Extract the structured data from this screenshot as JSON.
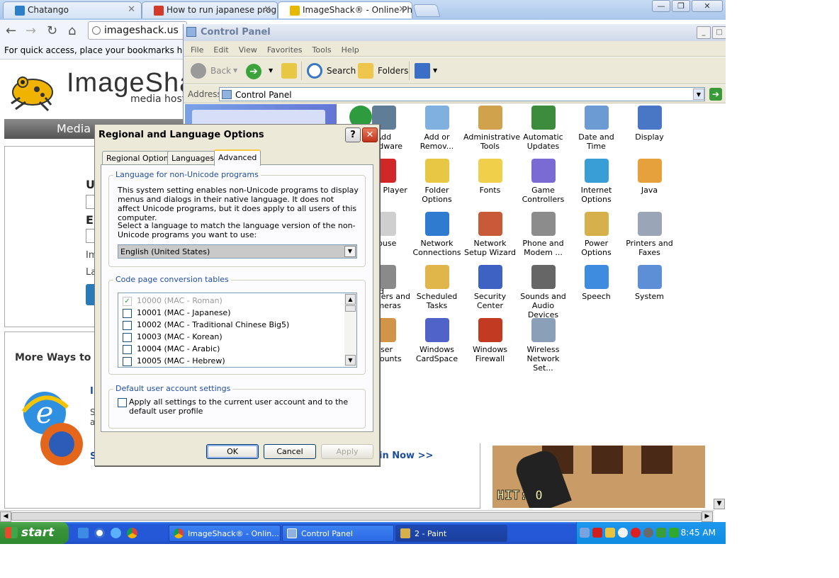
{
  "browser": {
    "tabs": [
      {
        "title": "Chatango"
      },
      {
        "title": "How to run japanese program"
      },
      {
        "title": "ImageShack® - Online Photo"
      }
    ],
    "url": "imageshack.us",
    "bookmark_hint": "For quick access, place your bookmarks here on the"
  },
  "imageshack": {
    "logo_text": "ImageShac",
    "logo_sub": "media hosti",
    "media_bar": "Media I",
    "letters": {
      "u": "U",
      "e": "E",
      "im": "Im",
      "la": "La"
    },
    "more_ways": "More Ways to Up",
    "sign_in": "in Now >>",
    "hit_label": "HIT: 0",
    "side_letters": {
      "i": "I",
      "s": "S",
      "a": "a",
      "s2": "S"
    }
  },
  "control_panel": {
    "title": "Control Panel",
    "menu": [
      "File",
      "Edit",
      "View",
      "Favorites",
      "Tools",
      "Help"
    ],
    "toolbar": {
      "back": "Back",
      "search": "Search",
      "folders": "Folders"
    },
    "address_label": "Address",
    "address_value": "Control Panel",
    "items": [
      {
        "label": "Add Hardware",
        "icon": "hardware-icon"
      },
      {
        "label": "Add or Remov...",
        "icon": "add-remove-icon"
      },
      {
        "label": "Administrative Tools",
        "icon": "admin-tools-icon"
      },
      {
        "label": "Automatic Updates",
        "icon": "updates-icon"
      },
      {
        "label": "Date and Time",
        "icon": "clock-icon"
      },
      {
        "label": "Display",
        "icon": "display-icon"
      },
      {
        "label": "Flash Player",
        "icon": "flash-icon"
      },
      {
        "label": "Folder Options",
        "icon": "folder-icon"
      },
      {
        "label": "Fonts",
        "icon": "fonts-icon"
      },
      {
        "label": "Game Controllers",
        "icon": "gamepad-icon"
      },
      {
        "label": "Internet Options",
        "icon": "globe-icon"
      },
      {
        "label": "Java",
        "icon": "java-icon"
      },
      {
        "label": "Mouse",
        "icon": "mouse-icon"
      },
      {
        "label": "Network Connections",
        "icon": "network-icon"
      },
      {
        "label": "Network Setup Wizard",
        "icon": "network-house-icon"
      },
      {
        "label": "Phone and Modem ...",
        "icon": "phone-icon"
      },
      {
        "label": "Power Options",
        "icon": "power-icon"
      },
      {
        "label": "Printers and Faxes",
        "icon": "printer-icon"
      },
      {
        "label": "Scanners and Cameras",
        "icon": "scanner-icon"
      },
      {
        "label": "Scheduled Tasks",
        "icon": "tasks-icon"
      },
      {
        "label": "Security Center",
        "icon": "shield-icon"
      },
      {
        "label": "Sounds and Audio Devices",
        "icon": "speaker-icon"
      },
      {
        "label": "Speech",
        "icon": "speech-icon"
      },
      {
        "label": "System",
        "icon": "system-icon"
      },
      {
        "label": "User Accounts",
        "icon": "users-icon"
      },
      {
        "label": "Windows CardSpace",
        "icon": "cardspace-icon"
      },
      {
        "label": "Windows Firewall",
        "icon": "firewall-icon"
      },
      {
        "label": "Wireless Network Set...",
        "icon": "wireless-icon"
      }
    ],
    "partial_letters": {
      "l1": "l",
      "d": "d",
      "l2": "l"
    }
  },
  "dialog": {
    "title": "Regional and Language Options",
    "tabs": [
      "Regional Options",
      "Languages",
      "Advanced"
    ],
    "active_tab": "Advanced",
    "group_nonunicode": {
      "label": "Language for non-Unicode programs",
      "desc": "This system setting enables non-Unicode programs to display menus and dialogs in their native language. It does not affect Unicode programs, but it does apply to all users of this computer.",
      "prompt": "Select a language to match the language version of the non-Unicode programs you want to use:",
      "selected": "English (United States)"
    },
    "group_codepage": {
      "label": "Code page conversion tables",
      "rows": [
        {
          "text": "10000 (MAC - Roman)",
          "checked": true,
          "disabled": true
        },
        {
          "text": "10001 (MAC - Japanese)",
          "checked": false,
          "disabled": false
        },
        {
          "text": "10002 (MAC - Traditional Chinese Big5)",
          "checked": false,
          "disabled": false
        },
        {
          "text": "10003 (MAC - Korean)",
          "checked": false,
          "disabled": false
        },
        {
          "text": "10004 (MAC - Arabic)",
          "checked": false,
          "disabled": false
        },
        {
          "text": "10005 (MAC - Hebrew)",
          "checked": false,
          "disabled": false
        }
      ]
    },
    "group_default": {
      "label": "Default user account settings",
      "checkbox": "Apply all settings to the current user account and to the default user profile"
    },
    "buttons": {
      "ok": "OK",
      "cancel": "Cancel",
      "apply": "Apply"
    }
  },
  "taskbar": {
    "start": "start",
    "tasks": [
      {
        "label": "ImageShack® - Onlin..."
      },
      {
        "label": "Control Panel"
      },
      {
        "label": "2 - Paint"
      }
    ],
    "clock": "8:45 AM"
  }
}
